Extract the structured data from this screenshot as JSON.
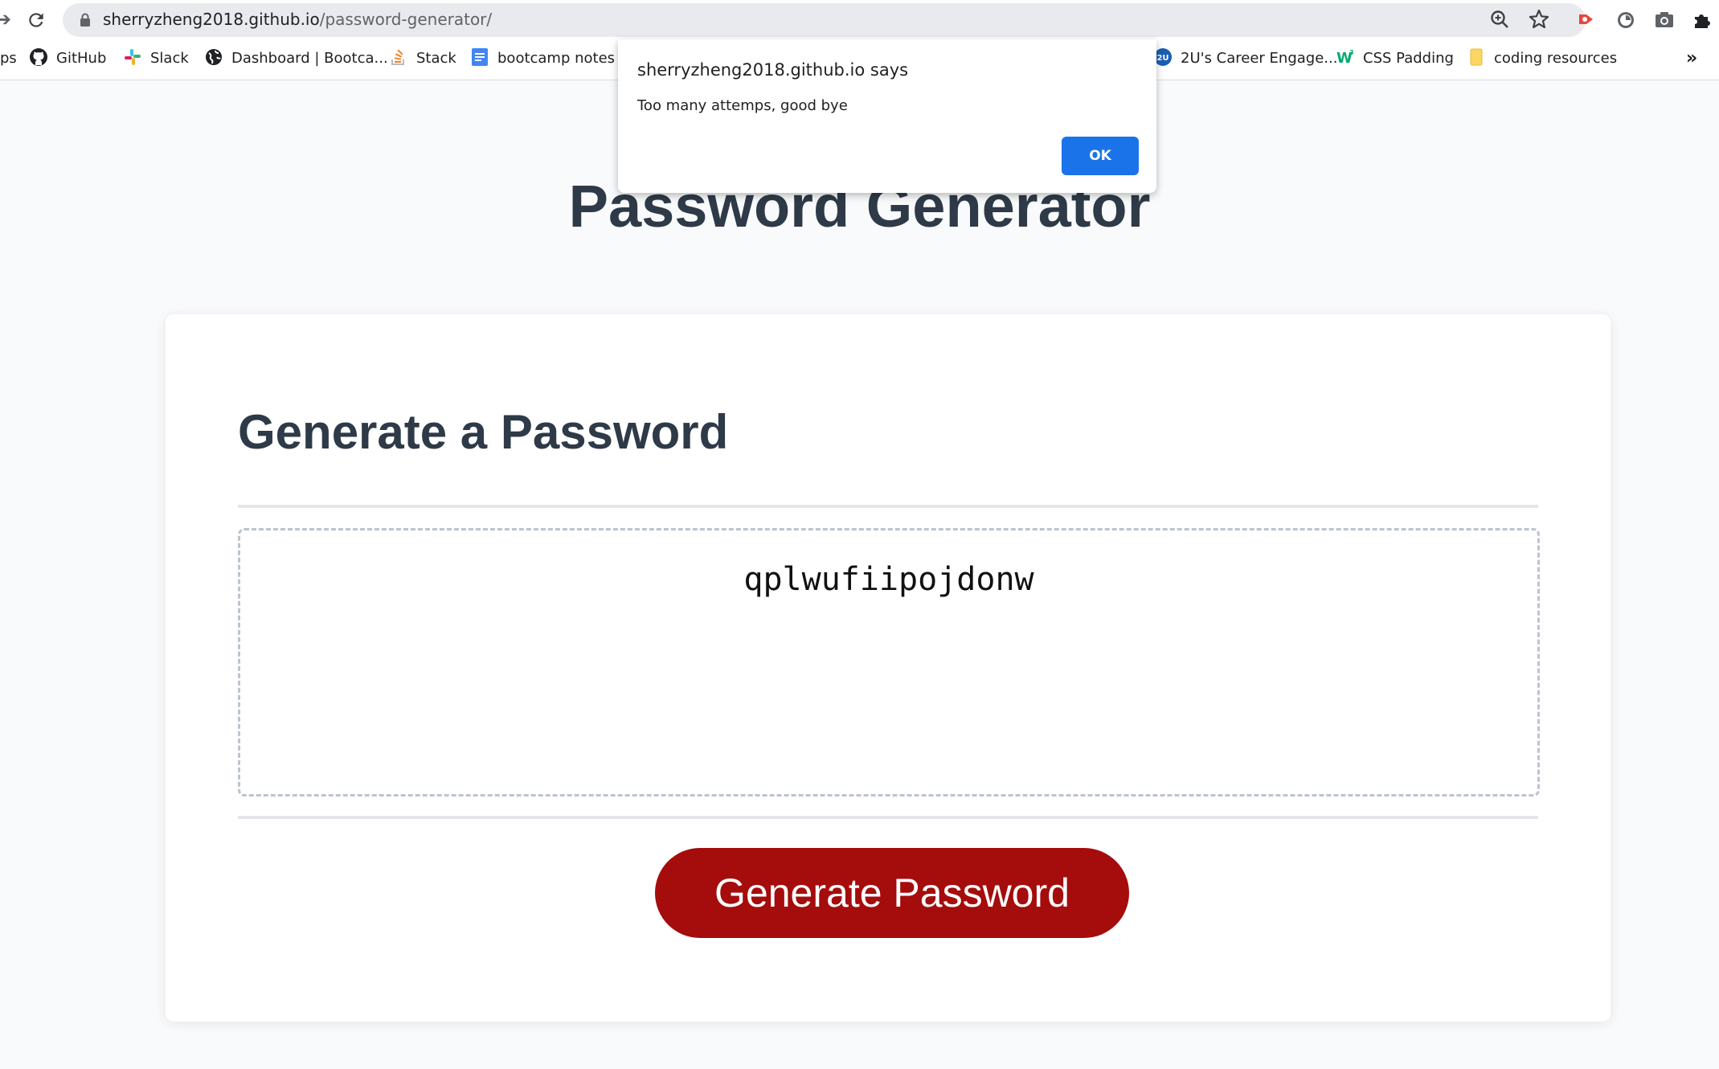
{
  "browser": {
    "url_host": "sherryzheng2018.github.io",
    "url_path": "/password-generator/",
    "extension_accent": "#e8453c"
  },
  "bookmarks": {
    "partial_left": "ps",
    "items": [
      {
        "label": "GitHub",
        "icon": "github-icon"
      },
      {
        "label": "Slack",
        "icon": "slack-icon"
      },
      {
        "label": "Dashboard | Bootca...",
        "icon": "globe-icon"
      },
      {
        "label": "Stack",
        "icon": "stackoverflow-icon"
      },
      {
        "label": "bootcamp notes -...",
        "icon": "google-docs-icon"
      },
      {
        "label": "2U's Career Engage...",
        "icon": "2u-icon"
      },
      {
        "label": "CSS Padding",
        "icon": "w3schools-icon"
      },
      {
        "label": "coding resources",
        "icon": "folder-icon"
      }
    ],
    "overflow": "»"
  },
  "page": {
    "title": "Password Generator",
    "card_heading": "Generate a Password",
    "password_value": "qplwufiipojdonw",
    "generate_button": "Generate Password",
    "button_color": "#a50c0c",
    "text_color": "#2e3a48"
  },
  "alert": {
    "title": "sherryzheng2018.github.io says",
    "message": "Too many attemps, good bye",
    "ok_label": "OK",
    "ok_color": "#1a73e8"
  }
}
